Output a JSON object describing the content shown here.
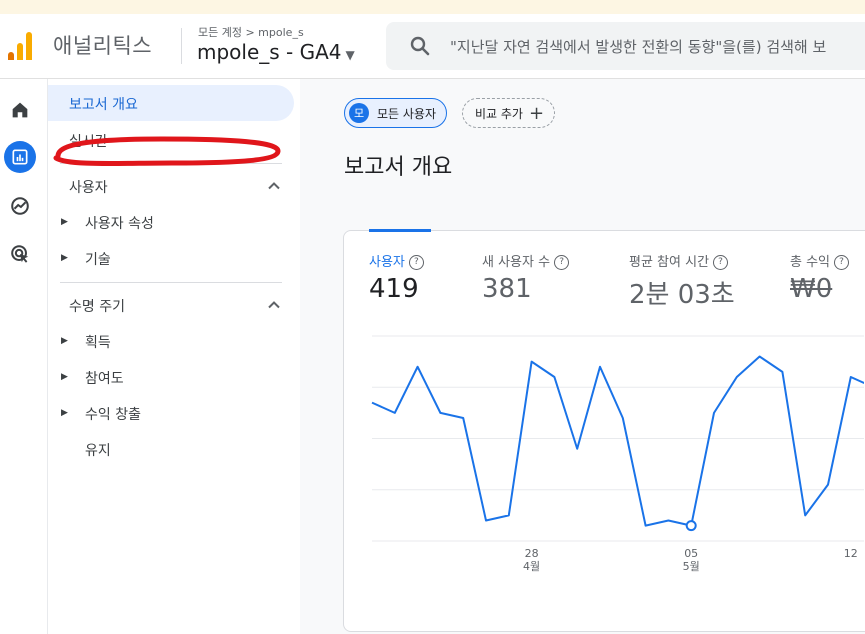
{
  "header": {
    "product_name": "애널리틱스",
    "breadcrumb": "모든 계정 > mpole_s",
    "property_name": "mpole_s - GA4",
    "search_placeholder": "\"지난달 자연 검색에서 발생한 전환의 동향\"을(를) 검색해 보"
  },
  "rail": {
    "items": [
      {
        "icon": "home-icon"
      },
      {
        "icon": "reports-icon",
        "active": true
      },
      {
        "icon": "explore-icon"
      },
      {
        "icon": "advertising-icon"
      }
    ]
  },
  "nav": {
    "overview": "보고서 개요",
    "realtime": "실시간",
    "section_user": "사용자",
    "user_attributes": "사용자 속성",
    "tech": "기술",
    "section_lifecycle": "수명 주기",
    "acquisition": "획득",
    "engagement": "참여도",
    "monetization": "수익 창출",
    "retention": "유지"
  },
  "main": {
    "chip_avatar": "모",
    "chip_all_users": "모든 사용자",
    "chip_add_compare": "비교 추가",
    "page_title": "보고서 개요"
  },
  "metrics": [
    {
      "label": "사용자",
      "value": "419"
    },
    {
      "label": "새 사용자 수",
      "value": "381"
    },
    {
      "label": "평균 참여 시간",
      "value": "2분 03초"
    },
    {
      "label": "총 수익",
      "value": "₩0"
    }
  ],
  "chart_data": {
    "type": "line",
    "series": [
      {
        "values": [
          17,
          15,
          24,
          15,
          14,
          -6,
          -5,
          25,
          22,
          8,
          24,
          14,
          -7,
          -6,
          -7,
          15,
          22,
          26,
          23,
          -5,
          1,
          22,
          20
        ]
      }
    ],
    "x_ticks": [
      {
        "index": 7,
        "day": "28",
        "month": "4월"
      },
      {
        "index": 14,
        "day": "05",
        "month": "5월"
      },
      {
        "index": 21,
        "day": "12",
        "month": ""
      }
    ],
    "highlight_index": 14
  },
  "colors": {
    "accent": "#1a73e8",
    "logo_orange": "#f9ab00",
    "logo_dark": "#e37400",
    "annotation": "#e0161b"
  }
}
